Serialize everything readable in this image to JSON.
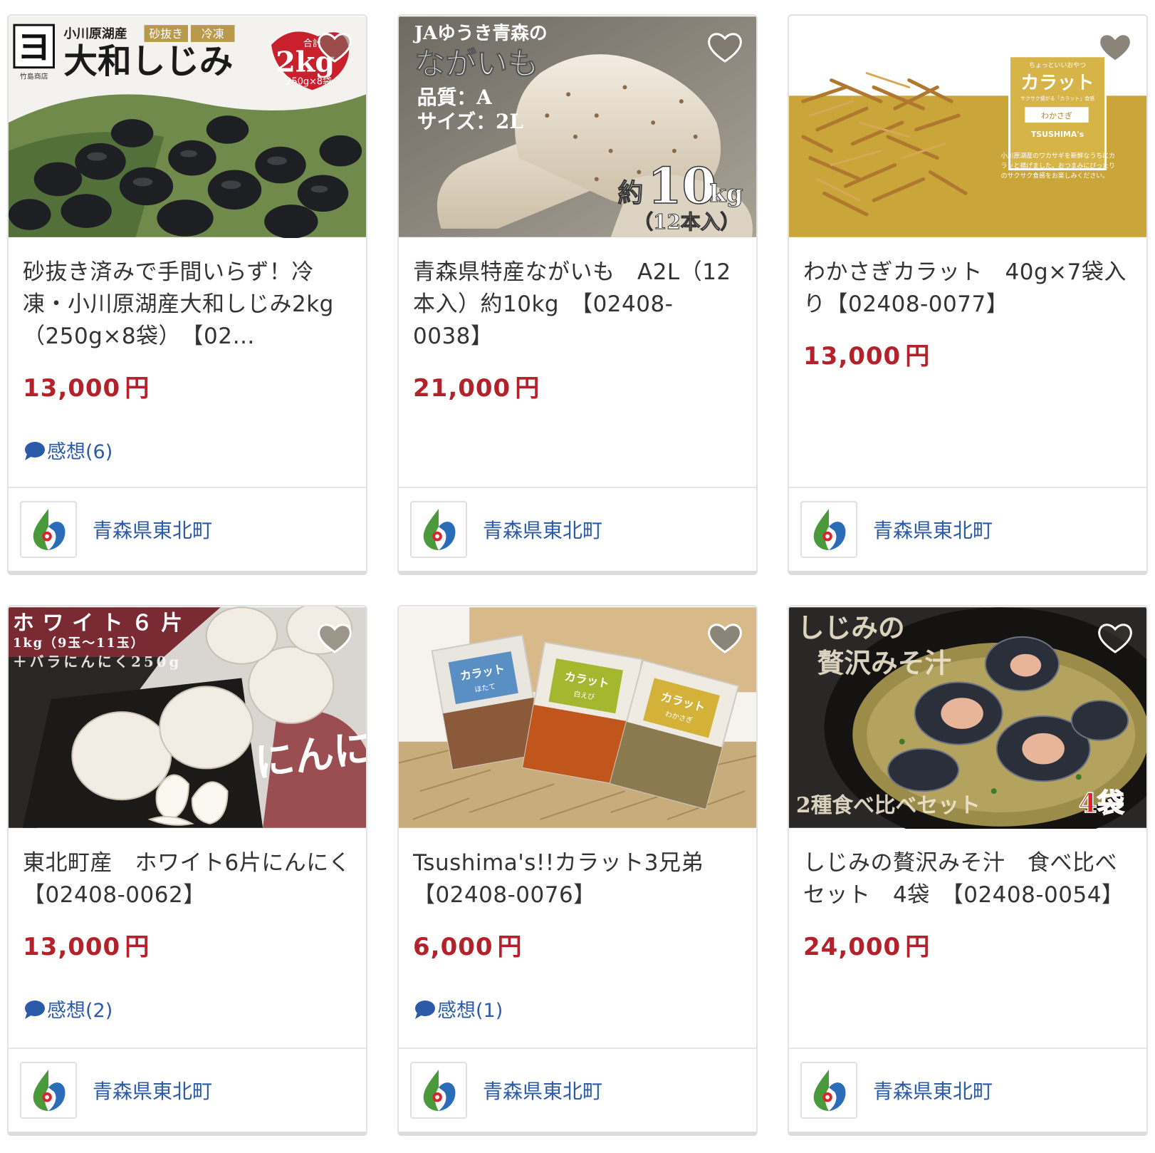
{
  "products": [
    {
      "title": "砂抜き済みで手間いらず！冷凍・小川原湖産大和しじみ2kg（250g×8袋）　【02…",
      "price": "13,000",
      "currency": "円",
      "review": "感想(6)",
      "municipality": "青森県東北町",
      "image": {
        "top_small": "小川原湖産",
        "tag1": "砂抜き",
        "tag2": "冷凍",
        "headline": "大和しじみ",
        "badge_big": "2kg",
        "badge_pre": "合計",
        "badge_sub": "250g×8袋",
        "shop": "竹島商店",
        "logo_char": "ヨ"
      }
    },
    {
      "title": "青森県特産ながいも　A2L（12本入）約10kg　【02408-0038】",
      "price": "21,000",
      "currency": "円",
      "municipality": "青森県東北町",
      "image": {
        "line1": "JAゆうき青森の",
        "line2": "ながいも",
        "line3": "品質：A",
        "line4": "サイズ：2L",
        "weight_pre": "約",
        "weight_num": "10",
        "weight_unit": "kg",
        "count": "（12本入）"
      }
    },
    {
      "title": "わかさぎカラット　40g×7袋入り【02408-0077】",
      "price": "13,000",
      "currency": "円",
      "municipality": "青森県東北町",
      "image": {
        "pkg_top": "ちょっといいおやつ",
        "pkg_name": "カラット",
        "pkg_sub": "サクサク揚がる「カラット」食感",
        "pkg_label": "わかさぎ",
        "pkg_brand": "TSUSHIMA's",
        "desc1": "小川原湖産のワカサギを新鮮なうちにカ",
        "desc2": "ラッと揚げました。おつまみにぴったり",
        "desc3": "のサクサク食感をお楽しみください。"
      }
    },
    {
      "title": "東北町産　ホワイト6片にんにく【02408-0062】",
      "price": "13,000",
      "currency": "円",
      "review": "感想(2)",
      "municipality": "青森県東北町",
      "image": {
        "line1": "ホワイト６片",
        "line2": "1kg（9玉～11玉）",
        "line3": "＋バラにんにく250g",
        "vertical": "にんにく"
      }
    },
    {
      "title": "Tsushima's!!カラット3兄弟　【02408-0076】",
      "price": "6,000",
      "currency": "円",
      "review": "感想(1)",
      "municipality": "青森県東北町",
      "image": {
        "bag1": "カラット",
        "bag1_sub": "ほたて",
        "bag2": "カラット",
        "bag2_sub": "白えび",
        "bag3": "カラット",
        "bag3_sub": "わかさぎ"
      }
    },
    {
      "title": "しじみの贅沢みそ汁　食べ比べセット　4袋　【02408-0054】",
      "price": "24,000",
      "currency": "円",
      "municipality": "青森県東北町",
      "image": {
        "line1": "しじみの",
        "line2": "贅沢みそ汁",
        "bottom": "2種食べ比べセット",
        "count": "4袋"
      }
    }
  ],
  "colors": {
    "price": "#b3222a",
    "link": "#2b5aa8",
    "border": "#e2e2e2",
    "muted_heart": "#8a8578"
  }
}
